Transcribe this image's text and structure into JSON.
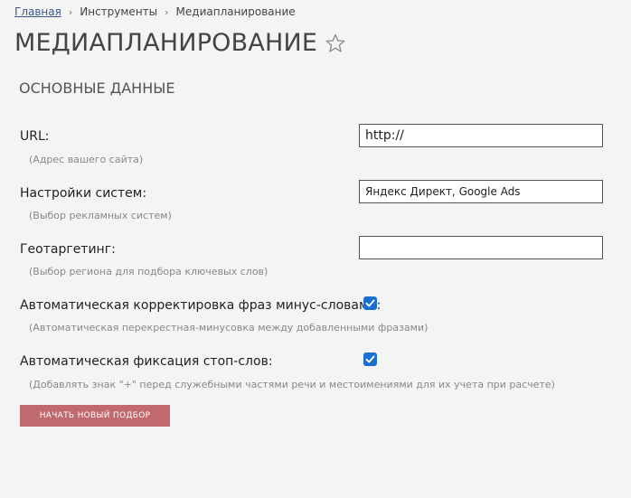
{
  "breadcrumb": {
    "items": [
      "Главная",
      "Инструменты",
      "Медиапланирование"
    ]
  },
  "page": {
    "title": "МЕДИАПЛАНИРОВАНИЕ",
    "star_icon": "star-outline-icon"
  },
  "section": {
    "title": "ОСНОВНЫЕ ДАННЫЕ"
  },
  "form": {
    "url": {
      "label": "URL:",
      "hint": "(Адрес вашего сайта)",
      "value": "http://"
    },
    "systems": {
      "label": "Настройки систем:",
      "hint": "(Выбор рекламных систем)",
      "value": "Яндекс Директ, Google Ads"
    },
    "geo": {
      "label": "Геотаргетинг:",
      "hint": "(Выбор региона для подбора ключевых слов)",
      "value": ""
    },
    "auto_minus": {
      "label": "Автоматическая корректировка фраз минус-словами:",
      "hint": "(Автоматическая перекрестная-минусовка между добавленными фразами)",
      "checked": true
    },
    "auto_stop": {
      "label": "Автоматическая фиксация стоп-слов:",
      "hint": "(Добавлять знак \"+\" перед служебными частями речи и местоимениями для их учета при расчете)",
      "checked": true
    },
    "submit_label": "НАЧАТЬ НОВЫЙ ПОДБОР"
  },
  "colors": {
    "accent_button": "#c0696f",
    "checkbox": "#1a6fd0",
    "link": "#3a5a8a"
  }
}
